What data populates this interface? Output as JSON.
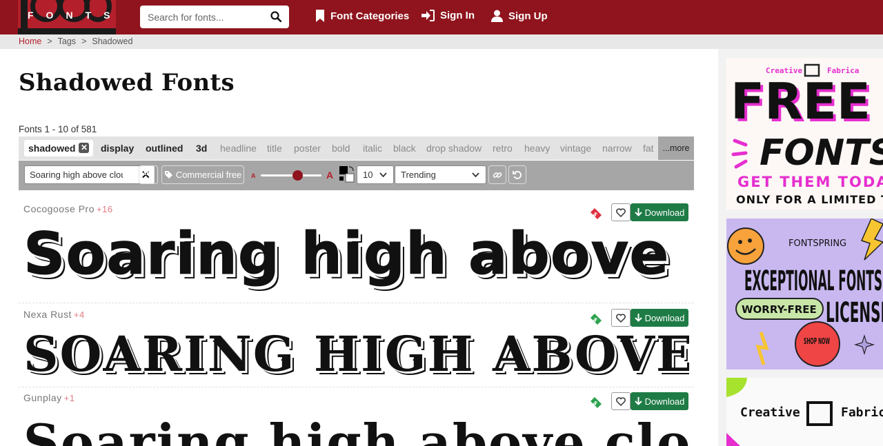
{
  "header": {
    "logo_text": "1001 FONTS",
    "logo_letters": "FONTS",
    "search_placeholder": "Search for fonts...",
    "nav": [
      {
        "label": "Font Categories",
        "icon": "bookmark-icon"
      },
      {
        "label": "Sign In",
        "icon": "sign-in-icon"
      },
      {
        "label": "Sign Up",
        "icon": "user-icon"
      }
    ]
  },
  "breadcrumb": {
    "items": [
      "Home",
      "Tags",
      "Shadowed"
    ],
    "separator": ">"
  },
  "page": {
    "title": "Shadowed Fonts",
    "count_text": "Fonts 1 - 10 of 581"
  },
  "tags": {
    "active": "shadowed",
    "bold_tags": [
      "display",
      "outlined",
      "3d"
    ],
    "tags": [
      "headline",
      "title",
      "poster",
      "bold",
      "italic",
      "black",
      "drop shadow",
      "retro",
      "heavy",
      "vintage",
      "narrow",
      "fat"
    ],
    "more_label": "...more"
  },
  "toolbar": {
    "preview_text": "Soaring high above clouds",
    "commercial_label": "Commercial free",
    "size_small_label": "A",
    "size_large_label": "A",
    "size_value": 0.6,
    "count_select": "10",
    "sort_select": "Trending"
  },
  "fonts": [
    {
      "name": "Cocogoose Pro",
      "extra": "+16",
      "preview": "Soaring high above",
      "tag_color": "#e03040",
      "download_label": "Download"
    },
    {
      "name": "Nexa Rust",
      "extra": "+4",
      "preview": "SOARING HIGH ABOVE",
      "tag_color": "#2ca24f",
      "download_label": "Download"
    },
    {
      "name": "Gunplay",
      "extra": "+1",
      "preview": "Soaring high above clouds",
      "tag_color": "#2ca24f",
      "download_label": "Download"
    }
  ],
  "ads": {
    "ad1": {
      "brand_left": "Creative",
      "brand_right": "Fabrica",
      "line1": "FREE",
      "line2": "FONTS",
      "line3": "GET THEM TODAY",
      "line4": "ONLY FOR A LIMITED TIME"
    },
    "ad2": {
      "brand": "FONTSPRING",
      "headline": "EXCEPTIONAL FONTS",
      "badge": "WORRY-FREE",
      "licensing": "LICENSING",
      "cta": "SHOP NOW"
    },
    "ad3": {
      "brand_left": "Creative",
      "brand_right": "Fabrica"
    }
  },
  "colors": {
    "brand": "#8f141d",
    "download": "#1e7b45",
    "accent": "#b3202b"
  }
}
